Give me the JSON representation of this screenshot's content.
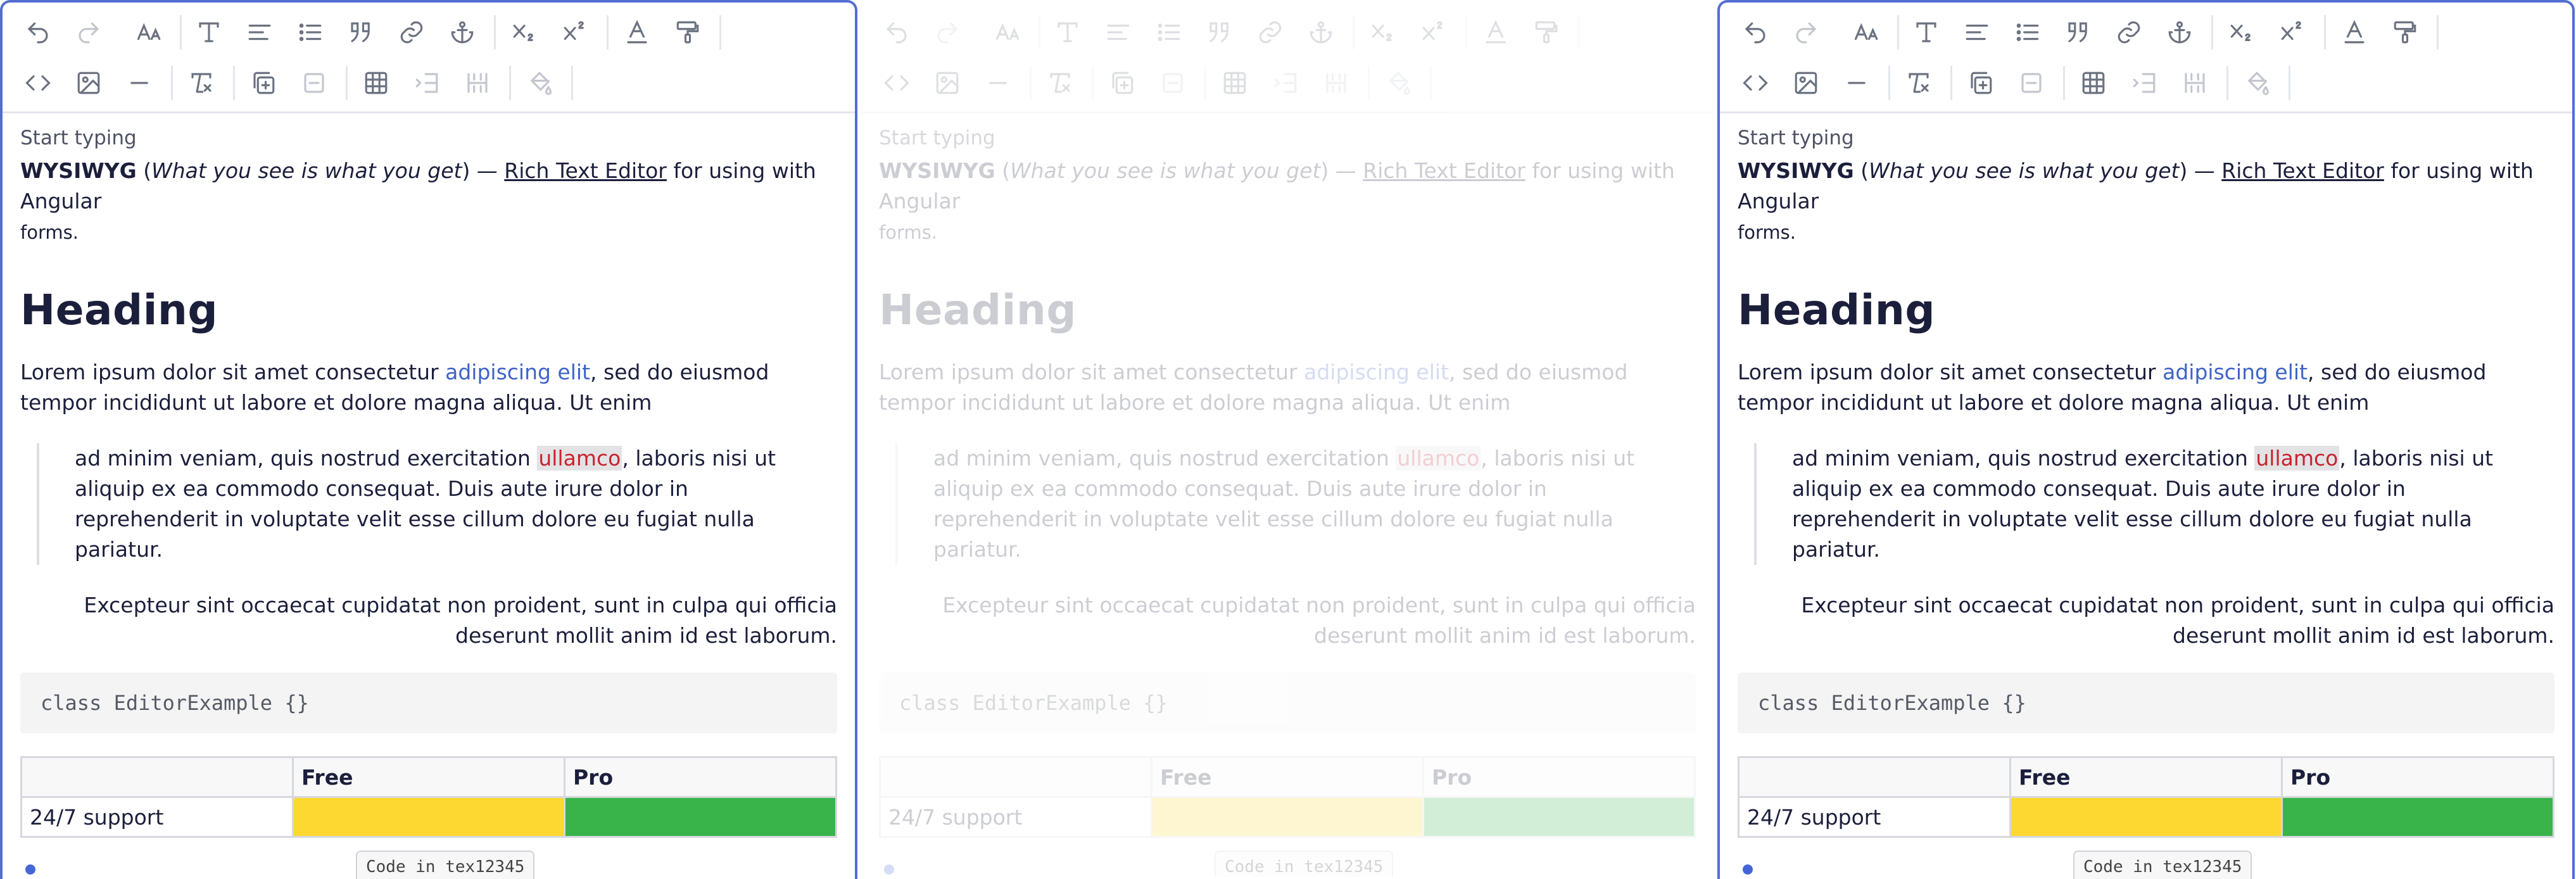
{
  "toolbar": {
    "row1": [
      "undo-icon",
      "redo-icon",
      "font-size-icon",
      "text-style-icon",
      "align-icon",
      "list-icon",
      "quote-icon",
      "link-icon",
      "anchor-icon",
      "subscript-icon",
      "superscript-icon",
      "text-color-icon",
      "paint-roller-icon"
    ],
    "row2": [
      "code-icon",
      "image-icon",
      "horizontal-rule-icon",
      "clear-format-icon",
      "insert-table-icon",
      "remove-icon",
      "table-icon",
      "table-row-icon",
      "table-cells-icon",
      "fill-color-icon"
    ]
  },
  "editor": {
    "placeholder": "Start typing",
    "intro": {
      "bold": "WYSIWYG",
      "open_paren": " (",
      "italic": "What you see is what you get",
      "after_italic": ") — ",
      "underline": "Rich Text Editor",
      "rest": " for using with Angular",
      "small": "forms."
    },
    "heading": "Heading",
    "para": {
      "before": "Lorem ipsum dolor sit amet consectetur ",
      "link": "adipiscing elit",
      "after": ", sed do eiusmod tempor incididunt ut labore et dolore magna aliqua. Ut enim"
    },
    "quote": {
      "before": "ad minim veniam, quis nostrud exercitation ",
      "mark": "ullamco",
      "after": ", laboris nisi ut aliquip ex ea commodo consequat. Duis aute irure dolor in reprehenderit in voluptate velit esse cillum dolore eu fugiat nulla pariatur."
    },
    "right_para": "Excepteur sint occaecat cupidatat non proident, sunt in culpa qui officia deserunt mollit anim id est laborum.",
    "code": "class EditorExample {}",
    "table": {
      "headers": [
        "",
        "Free",
        "Pro"
      ],
      "row": [
        "24/7 support",
        "",
        ""
      ],
      "colors": {
        "free": "#fdd830",
        "pro": "#38b44a"
      }
    },
    "badge": "Code in tex12345"
  },
  "colors": {
    "accent": "#526ed3",
    "link": "#3f63c8",
    "mark_text": "#c8232d"
  }
}
